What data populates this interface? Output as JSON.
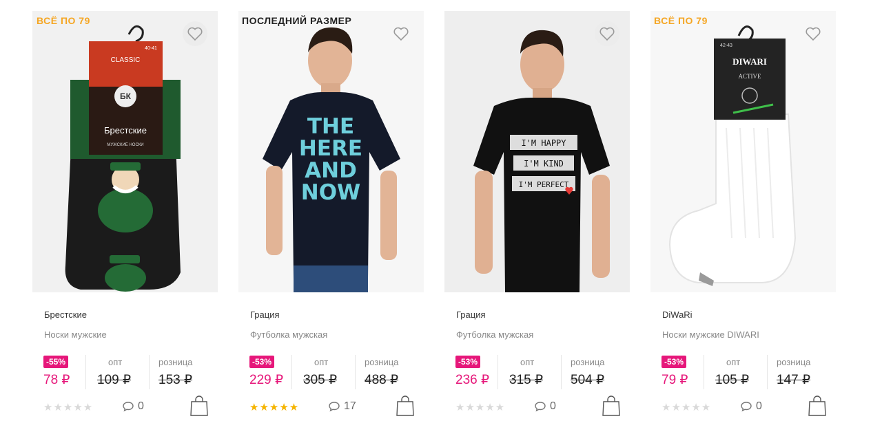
{
  "products": [
    {
      "promo": "ВСЁ ПО 79",
      "brand": "Брестские",
      "title": "Носки мужские",
      "discount": "-55%",
      "price": "78 ₽",
      "opt_label": "опт",
      "opt_price": "109 ₽",
      "retail_label": "розница",
      "retail_price": "153 ₽",
      "rating": 0,
      "comments": "0",
      "pack_brand": "Брестские",
      "pack_line": "CLASSIC",
      "pack_size": "40-41",
      "pack_sub": "МУЖСКИЕ НОСКИ"
    },
    {
      "promo": "ПОСЛЕДНИЙ РАЗМЕР",
      "brand": "Грация",
      "title": "Футболка мужская",
      "discount": "-53%",
      "price": "229 ₽",
      "opt_label": "опт",
      "opt_price": "305 ₽",
      "retail_label": "розница",
      "retail_price": "488 ₽",
      "rating": 5,
      "comments": "17",
      "shirt_print": [
        "THE",
        "HERE",
        "AND",
        "NOW"
      ]
    },
    {
      "promo": "",
      "brand": "Грация",
      "title": "Футболка мужская",
      "discount": "-53%",
      "price": "236 ₽",
      "opt_label": "опт",
      "opt_price": "315 ₽",
      "retail_label": "розница",
      "retail_price": "504 ₽",
      "rating": 0,
      "comments": "0",
      "shirt_print": [
        "I'M HAPPY",
        "I'M KIND",
        "I'M PERFECT"
      ]
    },
    {
      "promo": "ВСЁ ПО 79",
      "brand": "DiWaRi",
      "title": "Носки мужские DIWARI",
      "discount": "-53%",
      "price": "79 ₽",
      "opt_label": "опт",
      "opt_price": "105 ₽",
      "retail_label": "розница",
      "retail_price": "147 ₽",
      "rating": 0,
      "comments": "0",
      "pack_brand": "DIWARI",
      "pack_line": "ACTIVE",
      "pack_size": "42-43"
    }
  ],
  "colors": {
    "accent": "#e6177a",
    "promo_orange": "#f5a623",
    "star_on": "#f5b400",
    "star_off": "#d9d9d9",
    "text_muted": "#888888"
  },
  "icons": [
    "heart-icon",
    "comment-icon",
    "shopping-bag-icon",
    "star-icon"
  ]
}
